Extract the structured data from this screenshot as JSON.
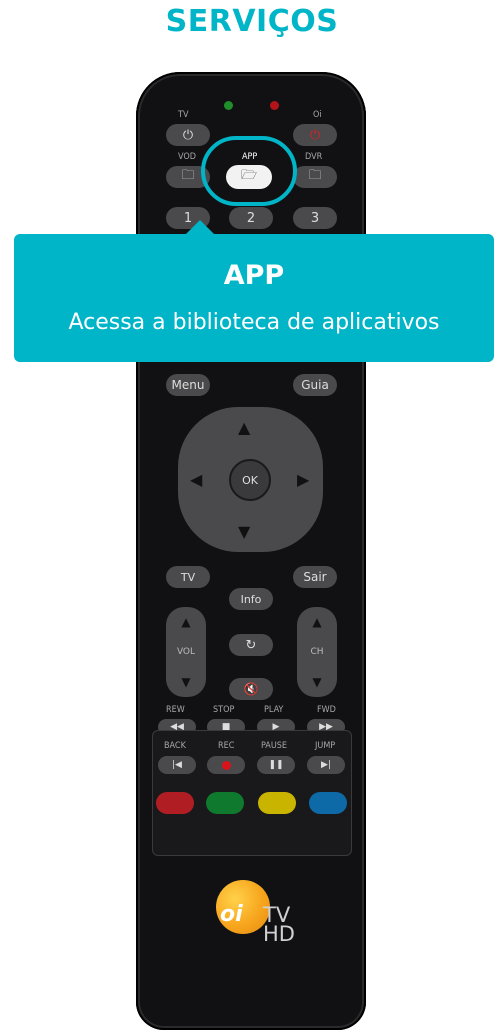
{
  "header": {
    "title": "SERVIÇOS"
  },
  "tooltip": {
    "title": "APP",
    "description": "Acessa a biblioteca de aplicativos"
  },
  "remote": {
    "labels": {
      "tv": "TV",
      "oi": "Oi",
      "vod": "VOD",
      "app": "APP",
      "dvr": "DVR",
      "vol": "VOL",
      "ch": "CH",
      "rew": "REW",
      "stop": "STOP",
      "play": "PLAY",
      "fwd": "FWD",
      "back": "BACK",
      "rec": "REC",
      "pause": "PAUSE",
      "jump": "JUMP"
    },
    "numbers": [
      "1",
      "2",
      "3"
    ],
    "buttons": {
      "menu": "Menu",
      "guia": "Guia",
      "ok": "OK",
      "info": "Info",
      "sair": "Sair",
      "tv_small": "TV"
    },
    "logo": {
      "brand": "oi",
      "line1": "TV",
      "line2": "HD"
    },
    "colors": {
      "accent": "#00b5c8",
      "body": "#111113",
      "button": "#4a4a4c",
      "red": "#b01e24",
      "green": "#0f7a2e",
      "yellow": "#c9b400",
      "blue": "#0d6aa6",
      "led_green": "#1f8f2a",
      "led_red": "#b3141a",
      "power_red": "#e02020"
    }
  }
}
